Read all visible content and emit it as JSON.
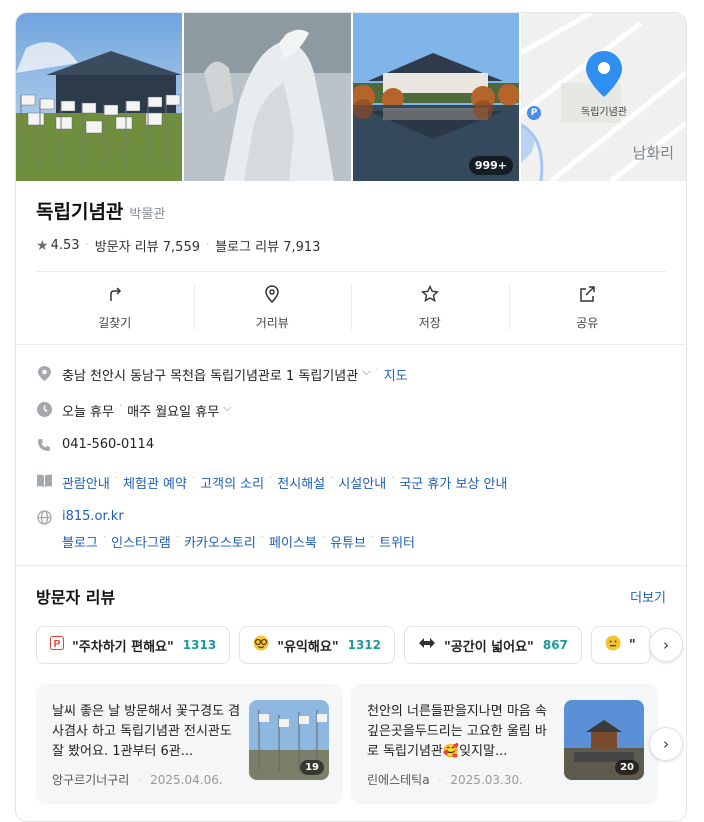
{
  "photos": {
    "more_count": "999+",
    "map_label": "독립기념관",
    "map_place": "남화리",
    "map_parking": "P"
  },
  "place": {
    "name": "독립기념관",
    "category": "박물관",
    "rating": "4.53",
    "visitor_reviews": "방문자 리뷰 7,559",
    "blog_reviews": "블로그 리뷰 7,913"
  },
  "actions": [
    {
      "label": "길찾기",
      "icon": "directions-icon"
    },
    {
      "label": "거리뷰",
      "icon": "street-view-icon"
    },
    {
      "label": "저장",
      "icon": "star-icon"
    },
    {
      "label": "공유",
      "icon": "share-icon"
    }
  ],
  "info": {
    "address": "충남 천안시 동남구 목천읍 독립기념관로 1 독립기념관",
    "map_link": "지도",
    "hours_status": "오늘 휴무",
    "hours_detail": "매주 월요일 휴무",
    "phone": "041-560-0114",
    "links": [
      "관람안내",
      "체험관 예약",
      "고객의 소리",
      "전시해설",
      "시설안내",
      "국군 휴가 보상 안내"
    ],
    "website": "i815.or.kr",
    "social": [
      "블로그",
      "인스타그램",
      "카카오스토리",
      "페이스북",
      "유튜브",
      "트위터"
    ]
  },
  "reviews": {
    "title": "방문자 리뷰",
    "more": "더보기",
    "chips": [
      {
        "icon": "parking-icon",
        "text": "\"주차하기 편해요\"",
        "count": "1313"
      },
      {
        "icon": "nerd-face-icon",
        "text": "\"유익해요\"",
        "count": "1312"
      },
      {
        "icon": "arrows-icon",
        "text": "\"공간이 넓어요\"",
        "count": "867"
      },
      {
        "icon": "thinking-face-icon",
        "text": "\"",
        "count": ""
      }
    ],
    "cards": [
      {
        "text": "날씨 좋은 날 방문해서 꽃구경도 겸사겸사 하고 독립기념관 전시관도 잘 봤어요. 1관부터 6관...",
        "author": "앙구르기너구리",
        "date": "2025.04.06.",
        "photo_count": "19"
      },
      {
        "text": "천안의 너른들판을지나면 마음 속깊은곳을두드리는 고요한 울림 바로 독립기념관🥰잊지말...",
        "author": "린에스테틱a",
        "date": "2025.03.30.",
        "photo_count": "20"
      }
    ]
  },
  "colors": {
    "link": "#1d5fb8",
    "count_teal": "#1a9b9b",
    "map_pin": "#2e8ff0"
  }
}
